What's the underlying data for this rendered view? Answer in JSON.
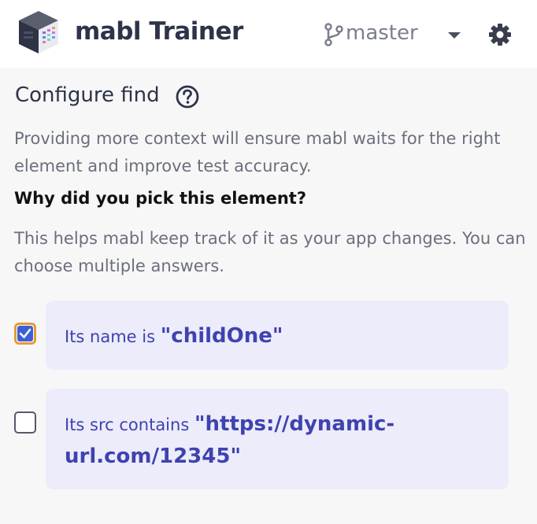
{
  "header": {
    "app_title": "mabl Trainer",
    "branch": "master",
    "logo_icon": "mabl-cube-logo",
    "branch_icon": "git-branch-icon",
    "caret_icon": "caret-down-icon",
    "settings_icon": "gear-icon"
  },
  "section": {
    "title": "Configure find",
    "help_icon": "help-circle-icon",
    "description": "Providing more context will ensure mabl waits for the right element and improve test accuracy."
  },
  "question": {
    "heading": "Why did you pick this element?",
    "hint": "This helps mabl keep track of it as your app changes. You can choose multiple answers."
  },
  "options": [
    {
      "checked": true,
      "prefix": "Its name is",
      "value": "\"childOne\""
    },
    {
      "checked": false,
      "prefix": "Its src contains",
      "value_line1": "\"https://dynamic-",
      "value_line2": "url.com/12345\""
    }
  ],
  "colors": {
    "title": "#2e3349",
    "accent_text": "#3f42b0",
    "card_bg": "#ececfa",
    "checkbox_focus": "#e49c3a",
    "checkbox_fill": "#3d5fd6"
  }
}
